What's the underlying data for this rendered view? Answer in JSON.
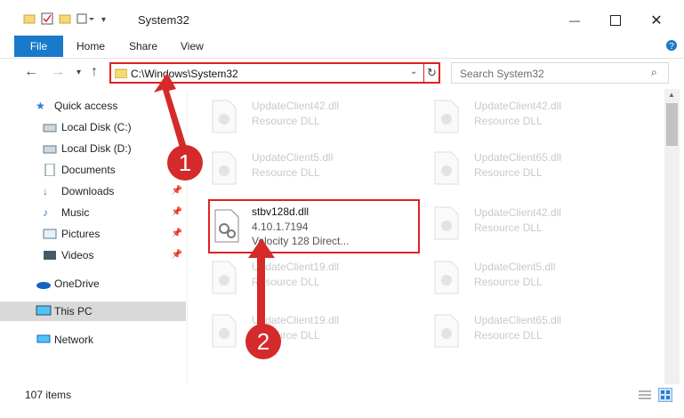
{
  "window": {
    "title": "System32",
    "controls": [
      "minimize-icon",
      "maximize-icon",
      "close-icon"
    ]
  },
  "ribbon": {
    "tabs": [
      "File",
      "Home",
      "Share",
      "View"
    ]
  },
  "address": {
    "path": "C:\\Windows\\System32",
    "search_placeholder": "Search System32"
  },
  "sidebar": {
    "items": [
      {
        "label": "Quick access",
        "icon": "star-icon"
      },
      {
        "label": "Local Disk (C:)",
        "icon": "drive-icon"
      },
      {
        "label": "Local Disk (D:)",
        "icon": "drive-icon"
      },
      {
        "label": "Documents",
        "icon": "documents-icon"
      },
      {
        "label": "Downloads",
        "icon": "download-icon"
      },
      {
        "label": "Music",
        "icon": "music-icon"
      },
      {
        "label": "Pictures",
        "icon": "pictures-icon"
      },
      {
        "label": "Videos",
        "icon": "videos-icon"
      },
      {
        "label": "OneDrive",
        "icon": "cloud-icon"
      },
      {
        "label": "This PC",
        "icon": "computer-icon"
      },
      {
        "label": "Network",
        "icon": "network-icon"
      }
    ]
  },
  "files": {
    "left": [
      {
        "name": "UpdateClient42.dll",
        "sub": "Resource DLL"
      },
      {
        "name": "UpdateClient5.dll",
        "sub": "Resource DLL"
      },
      {
        "name": "stbv128d.dll",
        "sub": "4.10.1.7194",
        "desc": "Velocity 128 Direct..."
      },
      {
        "name": "UpdateClient19.dll",
        "sub": "Resource DLL"
      },
      {
        "name": "UpdateClient19.dll",
        "sub": "Resource DLL"
      }
    ],
    "right": [
      {
        "name": "UpdateClient42.dll",
        "sub": "Resource DLL"
      },
      {
        "name": "UpdateClient65.dll",
        "sub": "Resource DLL"
      },
      {
        "name": "UpdateClient42.dll",
        "sub": "Resource DLL"
      },
      {
        "name": "UpdateClient5.dll",
        "sub": "Resource DLL"
      },
      {
        "name": "UpdateClient65.dll",
        "sub": "Resource DLL"
      }
    ]
  },
  "status": {
    "items_count": "107 items"
  },
  "annotations": {
    "marker1": "1",
    "marker2": "2"
  },
  "colors": {
    "accent": "#1979ca",
    "highlight": "#d22222",
    "marker": "#d42a2a"
  }
}
